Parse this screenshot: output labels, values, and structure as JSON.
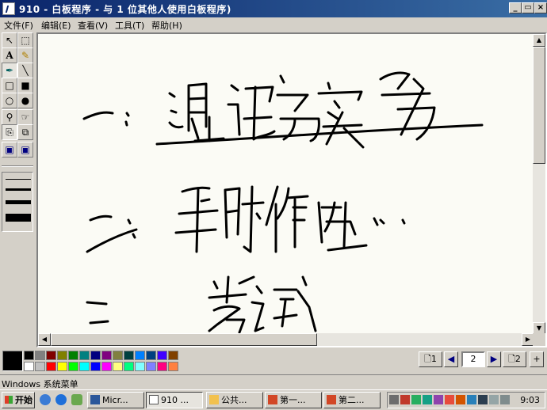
{
  "window": {
    "title": "910 - 白板程序 - 与 1 位其他人使用白板程序)",
    "minimize_label": "_",
    "maximize_label": "▭",
    "close_label": "×"
  },
  "menu": {
    "items": [
      {
        "label": "文件(F)"
      },
      {
        "label": "编辑(E)"
      },
      {
        "label": "查看(V)"
      },
      {
        "label": "工具(T)"
      },
      {
        "label": "帮助(H)"
      }
    ]
  },
  "tools": [
    {
      "icon": "arrow-select-icon",
      "glyph": "↖"
    },
    {
      "icon": "area-select-icon",
      "glyph": "⬚"
    },
    {
      "icon": "text-tool-icon",
      "glyph": "A"
    },
    {
      "icon": "highlighter-icon",
      "glyph": "✎"
    },
    {
      "icon": "pen-icon",
      "glyph": "✒"
    },
    {
      "icon": "line-icon",
      "glyph": "╲"
    },
    {
      "icon": "rect-outline-icon",
      "glyph": "□"
    },
    {
      "icon": "rect-filled-icon",
      "glyph": "■"
    },
    {
      "icon": "ellipse-outline-icon",
      "glyph": "○"
    },
    {
      "icon": "ellipse-filled-icon",
      "glyph": "●"
    },
    {
      "icon": "zoom-icon",
      "glyph": "⚲"
    },
    {
      "icon": "remote-pointer-icon",
      "glyph": "☞"
    },
    {
      "icon": "lock-contents-icon",
      "glyph": "⎘"
    },
    {
      "icon": "synchronize-icon",
      "glyph": "⧉"
    },
    {
      "icon": "select-window-icon",
      "glyph": "▣"
    },
    {
      "icon": "select-area-icon",
      "glyph": "▣"
    }
  ],
  "colors": {
    "current": "#000000",
    "palette_row1": [
      "#000000",
      "#808080",
      "#800000",
      "#808000",
      "#008000",
      "#008080",
      "#000080",
      "#800080",
      "#808040",
      "#004040",
      "#0080ff",
      "#004080",
      "#4000ff",
      "#804000"
    ],
    "palette_row2": [
      "#ffffff",
      "#c0c0c0",
      "#ff0000",
      "#ffff00",
      "#00ff00",
      "#00ffff",
      "#0000ff",
      "#ff00ff",
      "#ffff80",
      "#00ff80",
      "#80ffff",
      "#8080ff",
      "#ff0080",
      "#ff8040"
    ]
  },
  "pages": {
    "first_label": "1",
    "current": "2",
    "last_label": "2"
  },
  "status": {
    "text": "Windows 系统菜单"
  },
  "taskbar": {
    "start_label": "开始",
    "tasks": [
      {
        "label": "Micr...",
        "icon": "word-icon"
      },
      {
        "label": "910 ...",
        "icon": "whiteboard-icon"
      },
      {
        "label": "公共...",
        "icon": "folder-icon"
      },
      {
        "label": "第一...",
        "icon": "powerpoint-icon"
      },
      {
        "label": "第二...",
        "icon": "powerpoint-icon"
      }
    ],
    "clock": "9:03"
  }
}
